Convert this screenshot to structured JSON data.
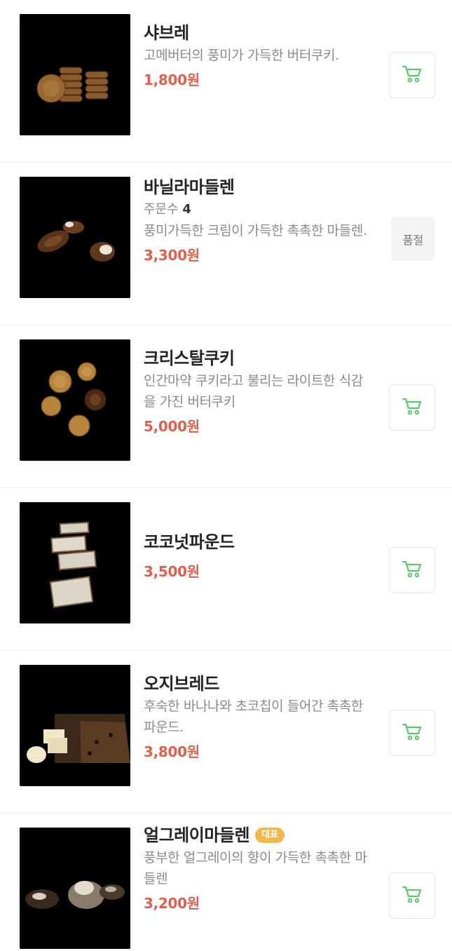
{
  "currency_suffix": "원",
  "accent_color": "#e0604e",
  "cart_icon_color": "#5cc66a",
  "products": [
    {
      "name": "샤브레",
      "badge": "",
      "orders_label": "",
      "orders_count": "",
      "description": "고메버터의 풍미가 가득한 버터쿠키.",
      "price": "1,800원",
      "action": "cart",
      "action_icon": "cart-icon"
    },
    {
      "name": "바닐라마들렌",
      "badge": "",
      "orders_label": "주문수",
      "orders_count": "4",
      "description": "풍미가득한 크림이 가득한 촉촉한 마들렌.",
      "price": "3,300원",
      "action": "soldout",
      "soldout_label": "품절"
    },
    {
      "name": "크리스탈쿠키",
      "badge": "",
      "orders_label": "",
      "orders_count": "",
      "description": "인간마약 쿠키라고 불리는 라이트한 식감을 가진 버터쿠키",
      "price": "5,000원",
      "action": "cart",
      "action_icon": "cart-icon"
    },
    {
      "name": "코코넛파운드",
      "badge": "",
      "orders_label": "",
      "orders_count": "",
      "description": "",
      "price": "3,500원",
      "action": "cart",
      "action_icon": "cart-icon"
    },
    {
      "name": "오지브레드",
      "badge": "",
      "orders_label": "",
      "orders_count": "",
      "description": "후숙한 바나나와 초코칩이 들어간 촉촉한 파운드.",
      "price": "3,800원",
      "action": "cart",
      "action_icon": "cart-icon"
    },
    {
      "name": "얼그레이마들렌",
      "badge": "대표",
      "orders_label": "",
      "orders_count": "",
      "description": "풍부한 얼그레이의 향이 가득한 촉촉한 마들렌",
      "price": "3,200원",
      "action": "cart",
      "action_icon": "cart-icon"
    }
  ]
}
